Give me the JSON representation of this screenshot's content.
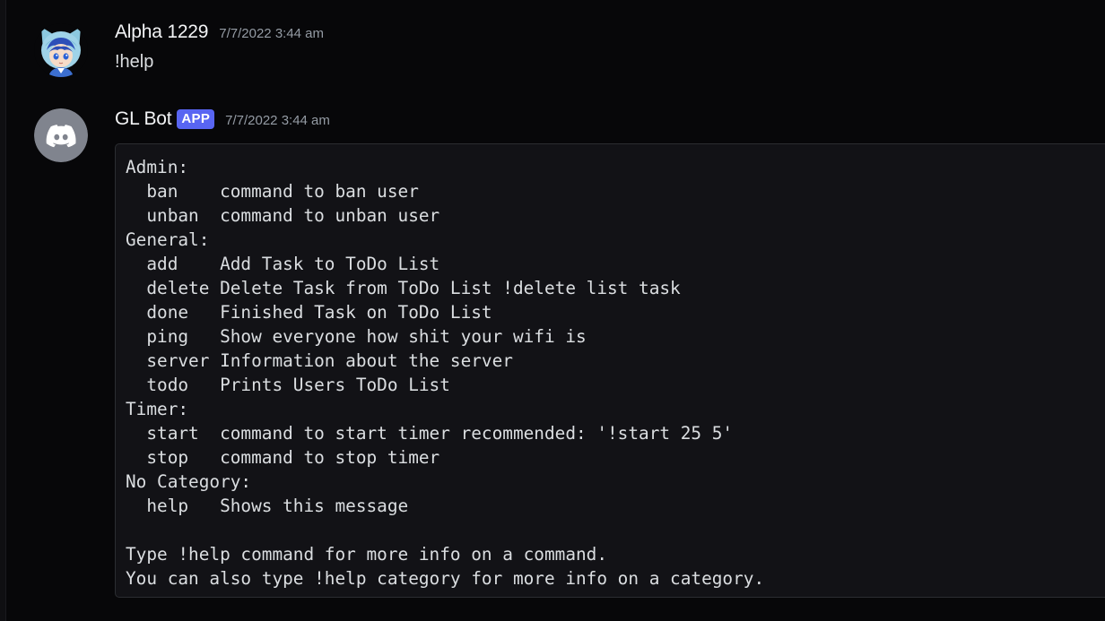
{
  "messages": [
    {
      "author": "Alpha 1229",
      "timestamp": "7/7/2022 3:44 am",
      "content": "!help",
      "avatar": "anime-character-avatar"
    },
    {
      "author": "GL Bot",
      "badge": "APP",
      "timestamp": "7/7/2022 3:44 am",
      "avatar": "discord-logo-icon",
      "code_lines": [
        "Admin:",
        "  ban    command to ban user",
        "  unban  command to unban user",
        "General:",
        "  add    Add Task to ToDo List",
        "  delete Delete Task from ToDo List !delete list task",
        "  done   Finished Task on ToDo List",
        "  ping   Show everyone how shit your wifi is",
        "  server Information about the server",
        "  todo   Prints Users ToDo List",
        "Timer:",
        "  start  command to start timer recommended: '!start 25 5'",
        "  stop   command to stop timer",
        "No Category:",
        "  help   Shows this message",
        "",
        "Type !help command for more info on a command.",
        "You can also type !help category for more info on a category."
      ]
    }
  ],
  "colors": {
    "background": "#070709",
    "codeblock_bg": "#121216",
    "badge": "#5865f2",
    "username": "#f2f3f5",
    "timestamp": "#949ba4",
    "text": "#dbdee1",
    "bot_avatar_bg": "#80848e"
  }
}
